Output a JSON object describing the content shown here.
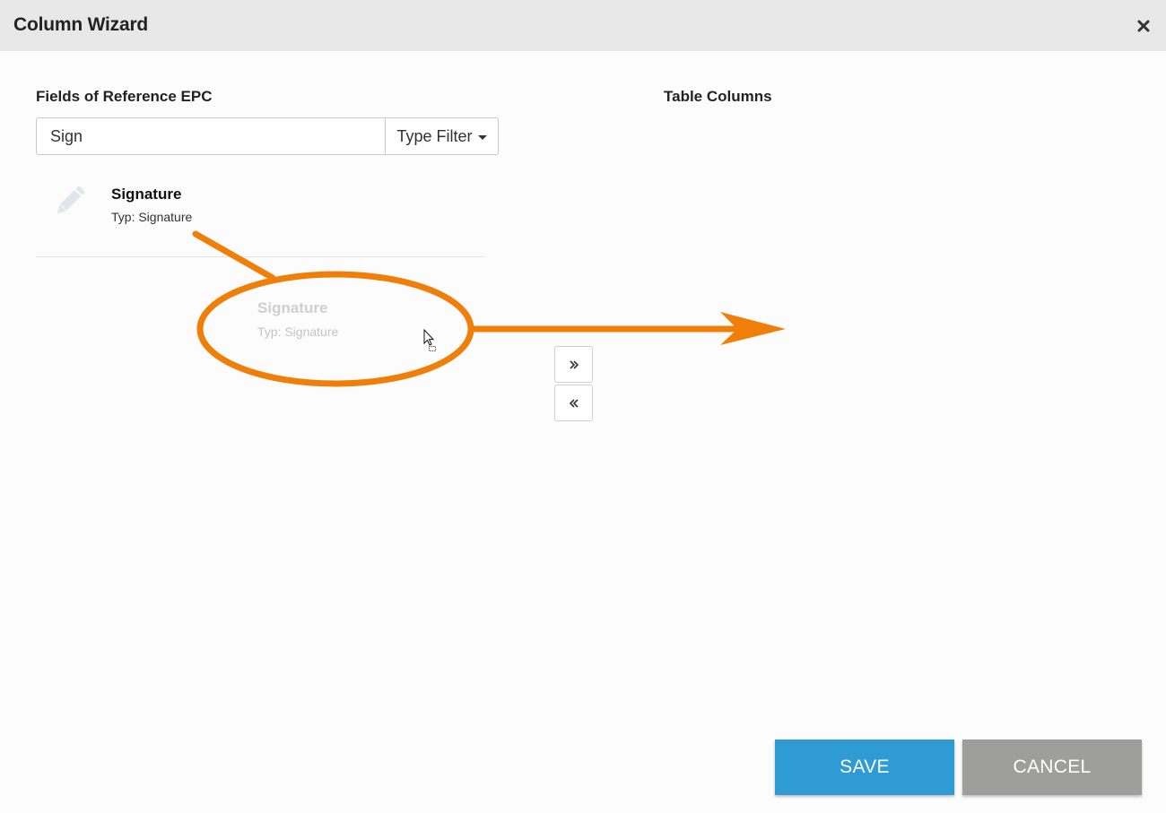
{
  "dialog": {
    "title": "Column Wizard"
  },
  "left_panel": {
    "title": "Fields of Reference EPC",
    "search": {
      "value": "Sign",
      "placeholder": ""
    },
    "filter_label": "Type Filter",
    "items": [
      {
        "name": "Signature",
        "type": "Typ: Signature",
        "icon": "pencil-icon"
      }
    ]
  },
  "drag_ghost": {
    "name": "Signature",
    "type": "Typ: Signature"
  },
  "right_panel": {
    "title": "Table Columns"
  },
  "footer": {
    "save_label": "SAVE",
    "cancel_label": "CANCEL"
  },
  "colors": {
    "header_bg": "#e8e8e8",
    "accent_save": "#2e9bd4",
    "cancel_gray": "#9e9e9c",
    "annotation_orange": "#f07f0a",
    "pencil_icon": "#dde7ec"
  }
}
